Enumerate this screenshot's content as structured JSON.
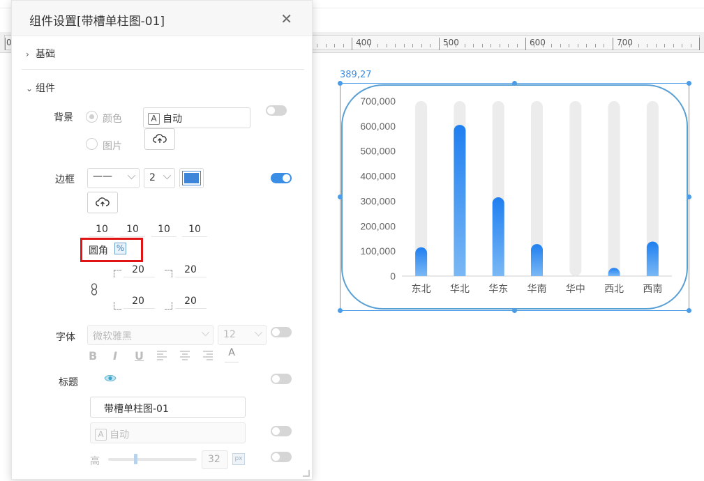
{
  "ruler": {
    "labels": [
      "0",
      "400",
      "500",
      "600",
      "700"
    ]
  },
  "panel": {
    "title": "组件设置[带槽单柱图-01]",
    "close_icon": "close-icon",
    "sections": {
      "basic": "基础",
      "component": "组件"
    },
    "background": {
      "label": "背景",
      "color_option": "颜色",
      "image_option": "图片",
      "color_value": "自动",
      "color_icon_letter": "A"
    },
    "border": {
      "label": "边框",
      "line_style": "——",
      "width": "2",
      "corners": [
        "10",
        "10",
        "10",
        "10"
      ]
    },
    "radius": {
      "label": "圆角",
      "percent_symbol": "%",
      "values": [
        "20",
        "20",
        "20",
        "20"
      ]
    },
    "font": {
      "label": "字体",
      "family_placeholder": "微软雅黑",
      "size": "12",
      "buttons": [
        "B",
        "I",
        "U"
      ],
      "color_letter": "A"
    },
    "title_row": {
      "label": "标题",
      "value": "带槽单柱图-01",
      "color_value": "自动",
      "color_icon_letter": "A"
    },
    "height": {
      "label": "高",
      "value": "32",
      "unit": "px"
    }
  },
  "canvas": {
    "coord_readout": "389,27"
  },
  "chart_data": {
    "type": "bar",
    "categories": [
      "东北",
      "华北",
      "华东",
      "华南",
      "华中",
      "西北",
      "西南"
    ],
    "values": [
      115000,
      605000,
      315000,
      128000,
      0,
      18000,
      138000
    ],
    "ylim": [
      0,
      700000
    ],
    "yticks": [
      0,
      100000,
      200000,
      300000,
      400000,
      500000,
      600000,
      700000
    ],
    "ytick_labels": [
      "0",
      "100,000",
      "200,000",
      "300,000",
      "400,000",
      "500,000",
      "600,000",
      "700,000"
    ],
    "title": "",
    "xlabel": "",
    "ylabel": "",
    "colors": {
      "bar_top": "#1f7ff0",
      "bar_bottom": "#7ab8f5",
      "track": "#ececec"
    },
    "grid": false
  }
}
